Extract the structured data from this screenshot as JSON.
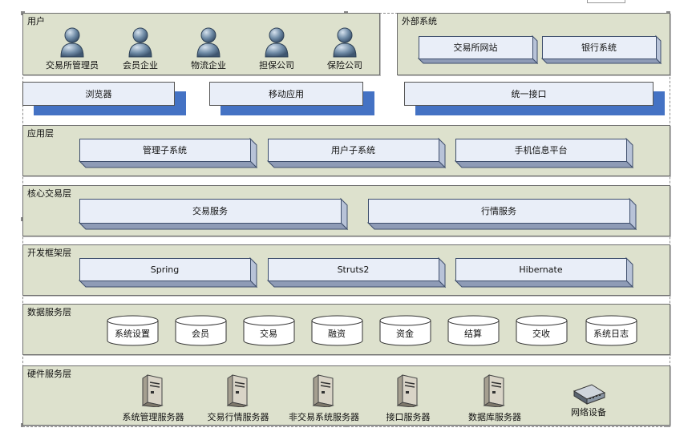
{
  "users": {
    "title": "用户",
    "items": [
      "交易所管理员",
      "会员企业",
      "物流企业",
      "担保公司",
      "保险公司"
    ]
  },
  "external": {
    "title": "外部系统",
    "items": [
      "交易所网站",
      "银行系统"
    ]
  },
  "access": [
    "浏览器",
    "移动应用",
    "统一接口"
  ],
  "app_layer": {
    "title": "应用层",
    "items": [
      "管理子系统",
      "用户子系统",
      "手机信息平台"
    ]
  },
  "core_layer": {
    "title": "核心交易层",
    "items": [
      "交易服务",
      "行情服务"
    ]
  },
  "framework_layer": {
    "title": "开发框架层",
    "items": [
      "Spring",
      "Struts2",
      "Hibernate"
    ]
  },
  "data_layer": {
    "title": "数据服务层",
    "items": [
      "系统设置",
      "会员",
      "交易",
      "融资",
      "资金",
      "结算",
      "交收",
      "系统日志"
    ]
  },
  "hardware_layer": {
    "title": "硬件服务层",
    "items": [
      "系统管理服务器",
      "交易行情服务器",
      "非交易系统服务器",
      "接口服务器",
      "数据库服务器",
      "网络设备"
    ]
  },
  "icons": {
    "user": "user-icon",
    "server": "server-icon",
    "network": "network-switch-icon",
    "database": "database-cylinder-icon"
  },
  "colors": {
    "panel": "#dde1cd",
    "box": "#e9eef8",
    "accent": "#4472c4",
    "user_icon": "#6f8ba6"
  }
}
